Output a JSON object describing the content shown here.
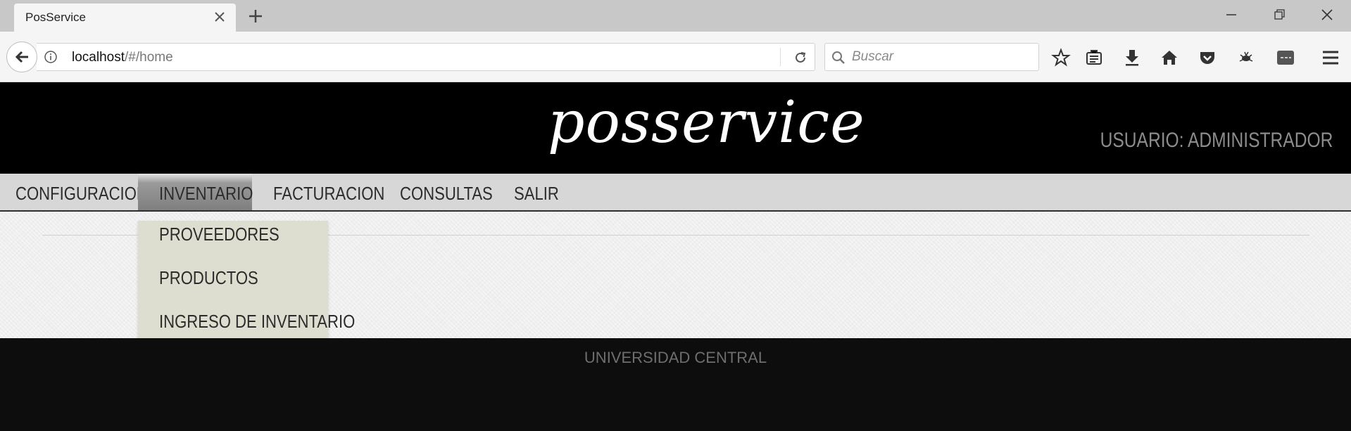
{
  "browser": {
    "tab_title": "PosService",
    "url_host": "localhost",
    "url_path": "/#/home",
    "search_placeholder": "Buscar"
  },
  "site": {
    "logo": "posservice",
    "user_label": "USUARIO: ADMINISTRADOR"
  },
  "menu": {
    "items": [
      {
        "label": "CONFIGURACION"
      },
      {
        "label": "INVENTARIO"
      },
      {
        "label": "FACTURACION"
      },
      {
        "label": "CONSULTAS"
      },
      {
        "label": "SALIR"
      }
    ],
    "active": "INVENTARIO"
  },
  "dropdown": {
    "items": [
      {
        "label": "PROVEEDORES"
      },
      {
        "label": "PRODUCTOS"
      },
      {
        "label": "INGRESO DE INVENTARIO"
      }
    ]
  },
  "footer": {
    "text": "UNIVERSIDAD CENTRAL"
  },
  "colors": {
    "header_bg": "#000000",
    "menu_bg": "#d7d7d7",
    "dropdown_bg": "#deded0",
    "footer_bg": "#0d0d0d"
  }
}
